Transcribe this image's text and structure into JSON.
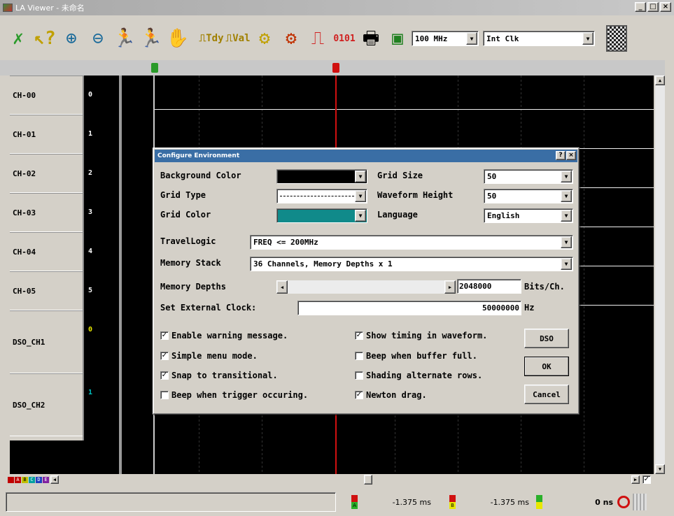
{
  "window": {
    "title": "LA Viewer - 未命名",
    "min": "_",
    "max": "□",
    "close": "×"
  },
  "toolbar": {
    "sample_rate": "100 MHz",
    "clock": "Int Clk"
  },
  "channels": [
    {
      "name": "CH-00",
      "num": "0"
    },
    {
      "name": "CH-01",
      "num": "1"
    },
    {
      "name": "CH-02",
      "num": "2"
    },
    {
      "name": "CH-03",
      "num": "3"
    },
    {
      "name": "CH-04",
      "num": "4"
    },
    {
      "name": "CH-05",
      "num": "5"
    },
    {
      "name": "DSO_CH1",
      "num": "0"
    },
    {
      "name": "DSO_CH2",
      "num": "1"
    }
  ],
  "colors": {
    "trace_dso": "#e8e800",
    "trace_dso2": "#00c0c0",
    "grid_color": "#108a8a",
    "cursor_marker": "#d01010"
  },
  "dialog": {
    "title": "Configure Environment",
    "help": "?",
    "close": "×",
    "labels": {
      "background_color": "Background Color",
      "grid_type": "Grid Type",
      "grid_color": "Grid Color",
      "grid_size": "Grid Size",
      "waveform_height": "Waveform Height",
      "language": "Language",
      "travel_logic": "TravelLogic",
      "memory_stack": "Memory Stack",
      "memory_depths": "Memory Depths",
      "set_external_clock": "Set External Clock:",
      "bits_per_ch": "Bits/Ch.",
      "hz": "Hz"
    },
    "values": {
      "grid_size": "50",
      "waveform_height": "50",
      "language": "English",
      "travel_logic": "FREQ <= 200MHz",
      "memory_stack": "36 Channels, Memory Depths x 1",
      "memory_depths": "2048000",
      "external_clock": "50000000"
    },
    "checkboxes": [
      {
        "label": "Enable warning message.",
        "checked": true
      },
      {
        "label": "Simple menu mode.",
        "checked": true
      },
      {
        "label": "Snap to transitional.",
        "checked": true
      },
      {
        "label": "Beep when trigger occuring.",
        "checked": false
      },
      {
        "label": "Show timing in waveform.",
        "checked": true
      },
      {
        "label": "Beep when buffer full.",
        "checked": false
      },
      {
        "label": "Shading alternate rows.",
        "checked": false
      },
      {
        "label": "Newton drag.",
        "checked": true
      }
    ],
    "buttons": {
      "dso": "DSO",
      "ok": "OK",
      "cancel": "Cancel"
    }
  },
  "status": {
    "time_a": "-1.375 ms",
    "time_b": "-1.375 ms",
    "time_c": "0 ns",
    "marker_a": "A",
    "marker_b": "B"
  },
  "color_tabs": [
    "A",
    "B",
    "C",
    "D",
    "E"
  ]
}
